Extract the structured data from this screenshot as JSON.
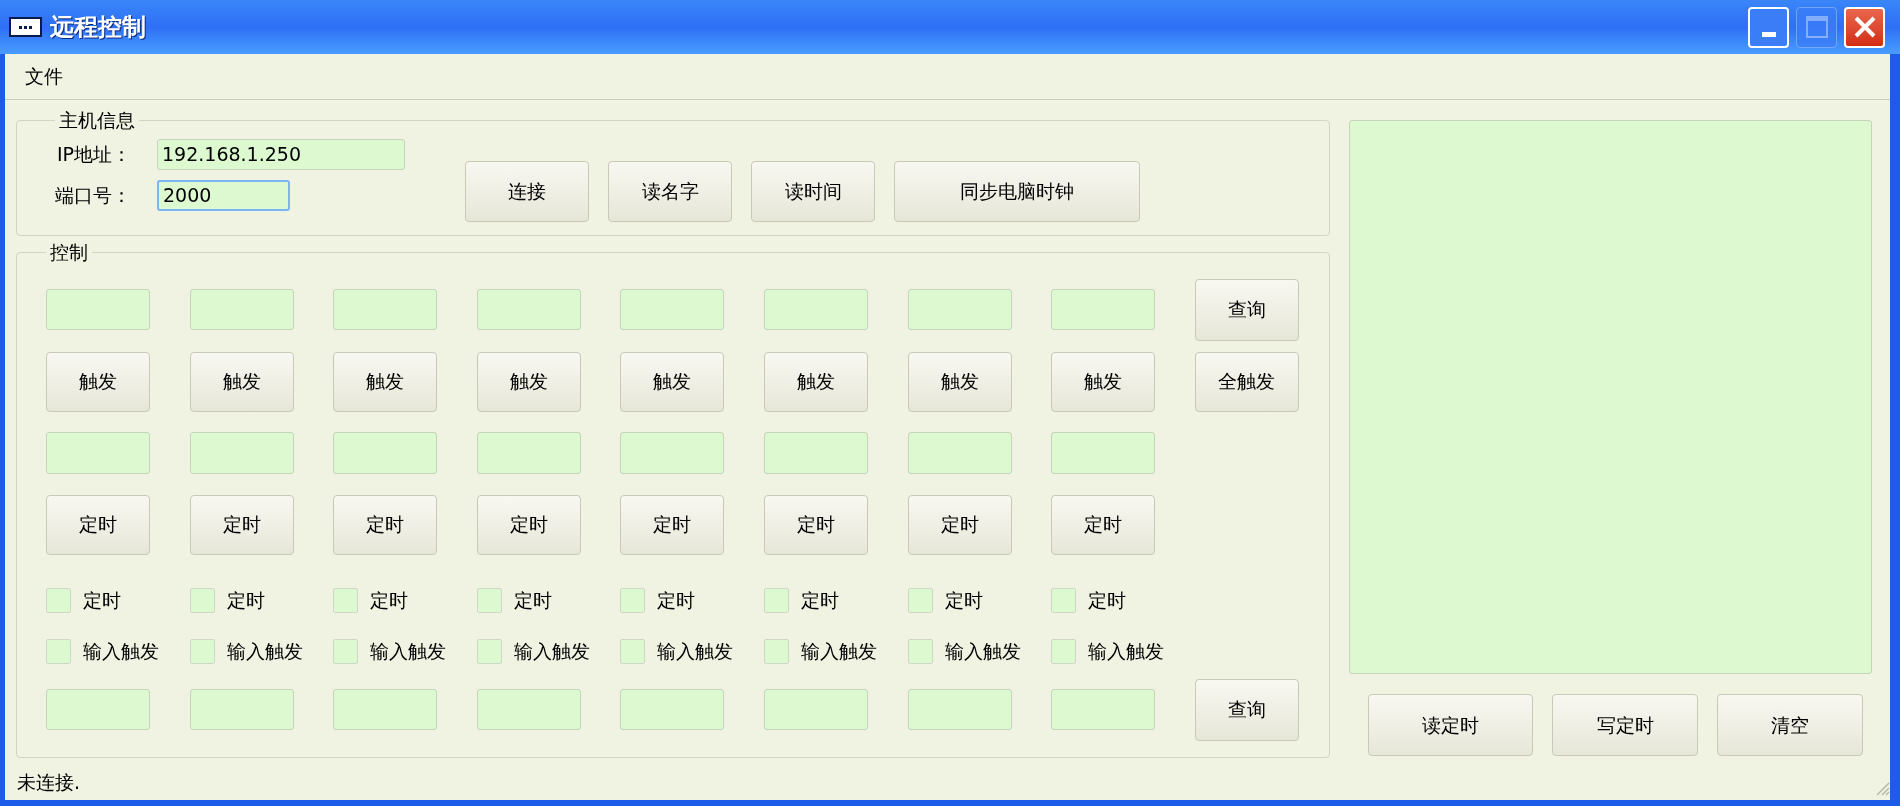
{
  "window": {
    "title": "远程控制"
  },
  "menu": [
    "文件"
  ],
  "host_info": {
    "legend": "主机信息",
    "fields": [
      {
        "label": "IP地址：",
        "value": "192.168.1.250",
        "focused": false
      },
      {
        "label": "端口号：",
        "value": "2000",
        "focused": true
      }
    ],
    "buttons": [
      "连接",
      "读名字",
      "读时间",
      "同步电脑时钟"
    ]
  },
  "control": {
    "legend": "控制",
    "query_top": "查询",
    "trigger_all": "全触发",
    "query_bottom": "查询",
    "channels": [
      {
        "trigger": "触发",
        "timer": "定时",
        "timer_check": {
          "label": "定时",
          "checked": false
        },
        "input_check": {
          "label": "输入触发",
          "checked": false
        }
      },
      {
        "trigger": "触发",
        "timer": "定时",
        "timer_check": {
          "label": "定时",
          "checked": false
        },
        "input_check": {
          "label": "输入触发",
          "checked": false
        }
      },
      {
        "trigger": "触发",
        "timer": "定时",
        "timer_check": {
          "label": "定时",
          "checked": false
        },
        "input_check": {
          "label": "输入触发",
          "checked": false
        }
      },
      {
        "trigger": "触发",
        "timer": "定时",
        "timer_check": {
          "label": "定时",
          "checked": false
        },
        "input_check": {
          "label": "输入触发",
          "checked": false
        }
      },
      {
        "trigger": "触发",
        "timer": "定时",
        "timer_check": {
          "label": "定时",
          "checked": false
        },
        "input_check": {
          "label": "输入触发",
          "checked": false
        }
      },
      {
        "trigger": "触发",
        "timer": "定时",
        "timer_check": {
          "label": "定时",
          "checked": false
        },
        "input_check": {
          "label": "输入触发",
          "checked": false
        }
      },
      {
        "trigger": "触发",
        "timer": "定时",
        "timer_check": {
          "label": "定时",
          "checked": false
        },
        "input_check": {
          "label": "输入触发",
          "checked": false
        }
      },
      {
        "trigger": "触发",
        "timer": "定时",
        "timer_check": {
          "label": "定时",
          "checked": false
        },
        "input_check": {
          "label": "输入触发",
          "checked": false
        }
      }
    ]
  },
  "right_panel": {
    "buttons": [
      "读定时",
      "写定时",
      "清空"
    ]
  },
  "status_bar": "未连接."
}
